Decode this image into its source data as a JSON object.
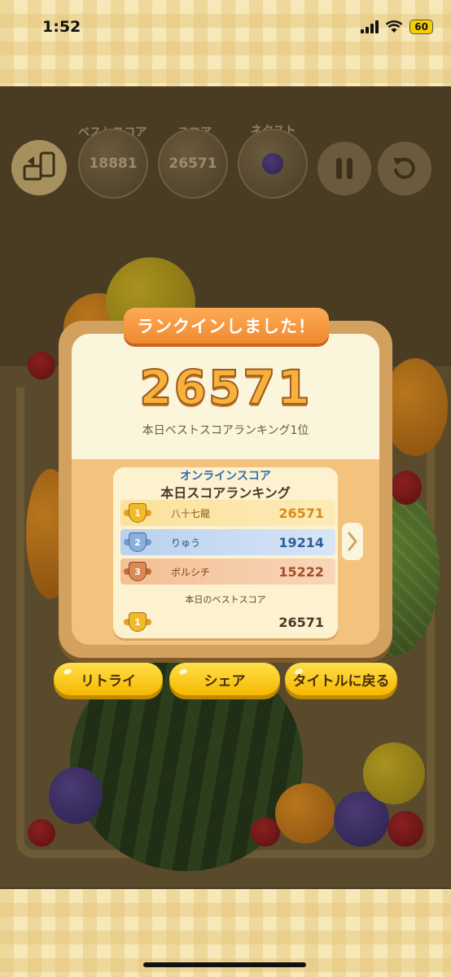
{
  "status": {
    "time": "1:52",
    "battery": "60"
  },
  "hud": {
    "best_label": "ベストスコア",
    "best_value": "18881",
    "score_label": "スコア",
    "score_value": "26571",
    "next_label": "ネクスト"
  },
  "popup": {
    "ribbon": "ランクインしました！",
    "score": "26571",
    "subtitle": "本日ベストスコアランキング1位",
    "board_title_1": "オンラインスコア",
    "board_title_2": "本日スコアランキング",
    "rows": [
      {
        "rank": "1",
        "name": "八十七龍",
        "score": "26571"
      },
      {
        "rank": "2",
        "name": "りゅう",
        "score": "19214"
      },
      {
        "rank": "3",
        "name": "ボルシチ",
        "score": "15222"
      }
    ],
    "best_label": "本日のベストスコア",
    "best_rank": "1",
    "best_score": "26571"
  },
  "buttons": {
    "retry": "リトライ",
    "share": "シェア",
    "title": "タイトルに戻る"
  },
  "colors": {
    "accent_yellow": "#f6b800",
    "ribbon_orange": "#f08a30",
    "score_gold": "#f7b13c"
  }
}
